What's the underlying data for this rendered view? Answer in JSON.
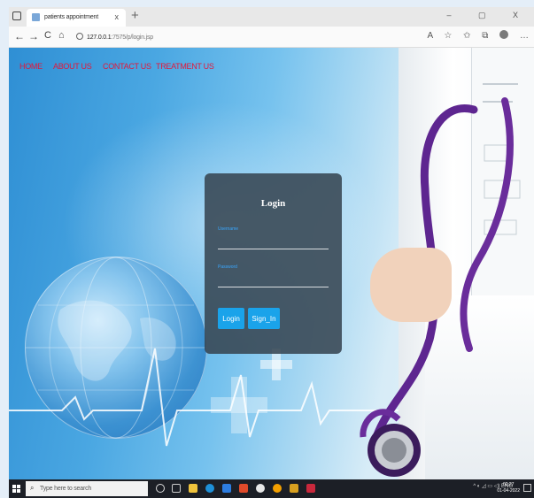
{
  "browser": {
    "tab_title": "patients appointment",
    "tab_close": "x",
    "new_tab": "+",
    "window_controls": "– ▢ X",
    "back": "←",
    "forward": "→",
    "refresh": "C",
    "home": "⌂",
    "url_host": "127.0.0.1",
    "url_path": ":7575/p/login.jsp"
  },
  "nav": {
    "home": "HOME",
    "about": "ABOUT US",
    "contact": "CONTACT US",
    "treatment": "TREATMENT US"
  },
  "login": {
    "title": "Login",
    "username_label": "Username",
    "password_label": "Password",
    "username_value": "",
    "password_value": "",
    "login_button": "Login",
    "signin_button": "Sign_In"
  },
  "taskbar": {
    "search_placeholder": "Type here to search",
    "tray": "ENG",
    "time": "02:27",
    "date": "01-04-2022"
  },
  "colors": {
    "nav_link": "#e3173a",
    "button": "#1aa3ea",
    "card": "#374652",
    "stethoscope": "#6a2d9b"
  }
}
